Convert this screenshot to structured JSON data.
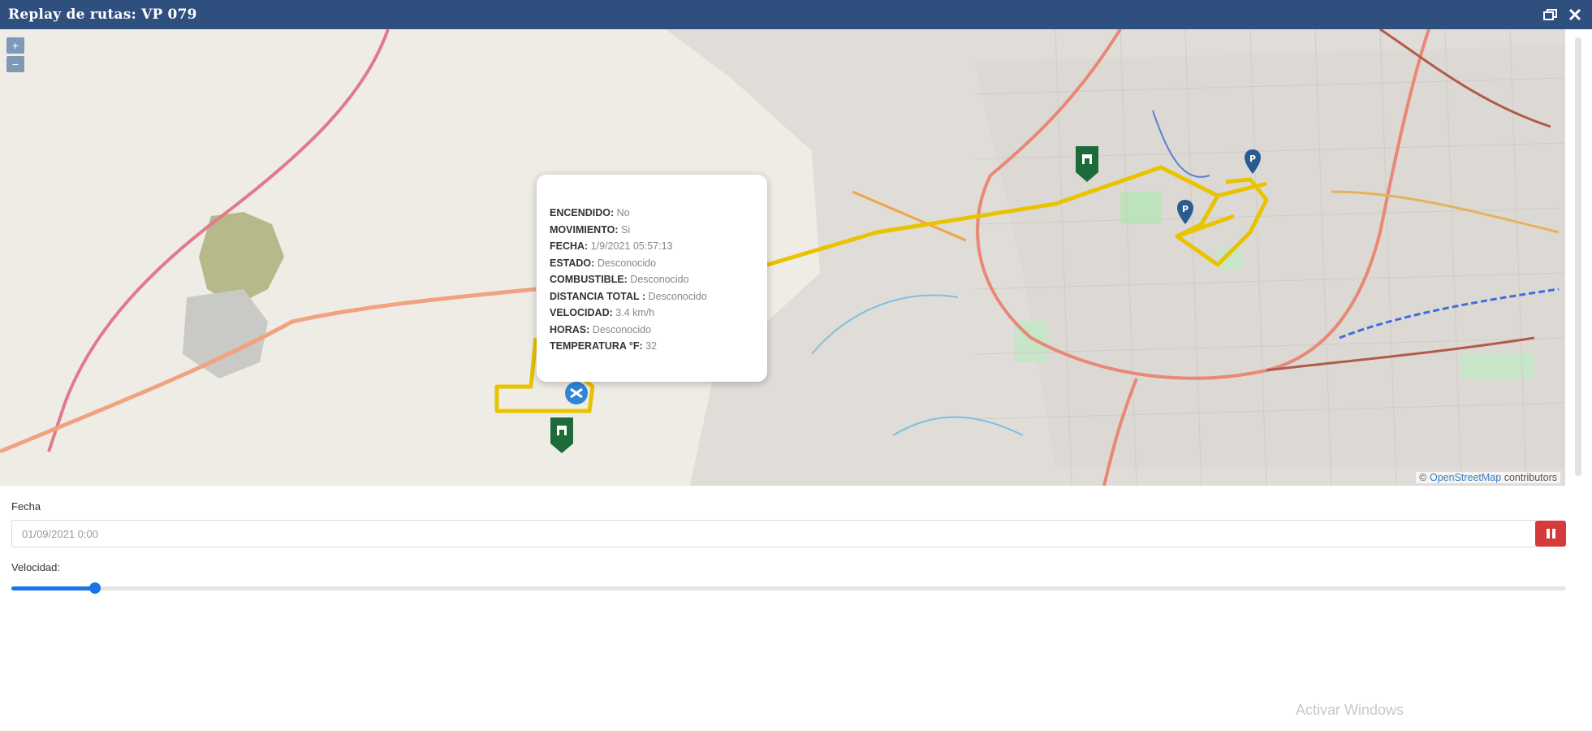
{
  "window": {
    "title": "Replay de rutas: VP 079",
    "restore_icon": "restore-window-icon",
    "close_icon": "close-icon"
  },
  "map": {
    "zoom_in": "+",
    "zoom_out": "−",
    "attribution_prefix": "© ",
    "attribution_link": "OpenStreetMap",
    "attribution_suffix": " contributors",
    "route_color": "#e8c300",
    "markers": [
      {
        "type": "start-marker",
        "color": "#1e6b3a"
      },
      {
        "type": "end-marker",
        "color": "#1e6b3a"
      },
      {
        "type": "vehicle-marker",
        "color": "#2f86d6"
      },
      {
        "type": "parking-marker",
        "color": "#2a5b8f"
      },
      {
        "type": "parking-marker",
        "color": "#2a5b8f"
      }
    ],
    "popup": {
      "rows": [
        {
          "label": "ENCENDIDO:",
          "value": "No"
        },
        {
          "label": "MOVIMIENTO:",
          "value": "Si"
        },
        {
          "label": "FECHA:",
          "value": "1/9/2021 05:57:13"
        },
        {
          "label": "ESTADO:",
          "value": "Desconocido"
        },
        {
          "label": "COMBUSTIBLE:",
          "value": "Desconocido"
        },
        {
          "label": "DISTANCIA TOTAL :",
          "value": "Desconocido"
        },
        {
          "label": "VELOCIDAD:",
          "value": "3.4 km/h"
        },
        {
          "label": "HORAS:",
          "value": "Desconocido"
        },
        {
          "label": "TEMPERATURA °F:",
          "value": "32"
        }
      ]
    }
  },
  "controls": {
    "fecha_label": "Fecha",
    "fecha_value": "01/09/2021 0:00",
    "pause_icon": "pause-icon",
    "pause_color": "#d63b3b",
    "velocidad_label": "Velocidad:",
    "velocidad_fraction": 0.054
  },
  "watermark": "Activar Windows"
}
